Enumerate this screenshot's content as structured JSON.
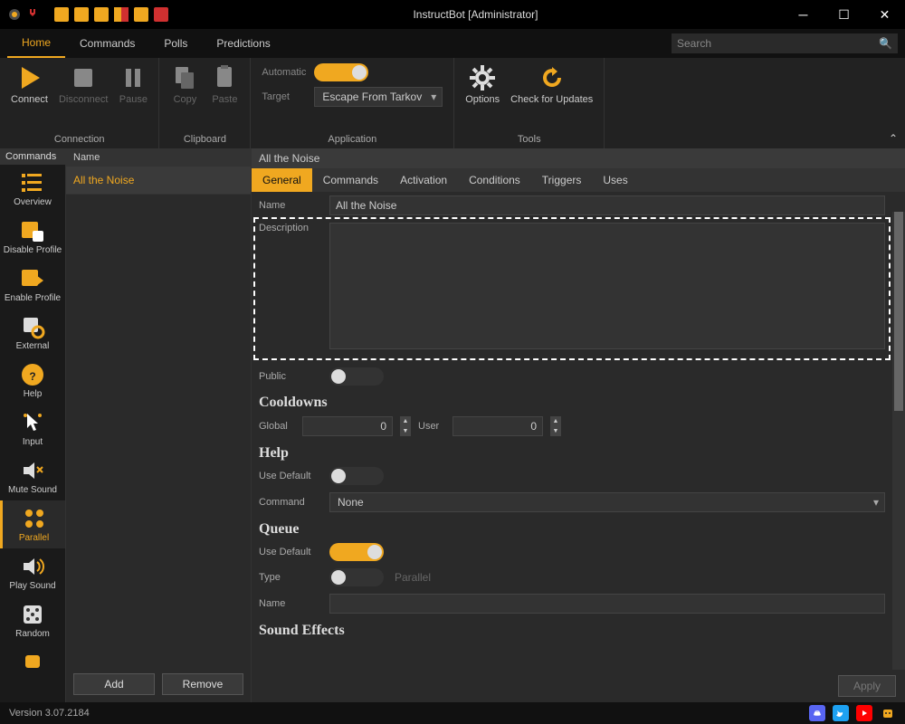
{
  "window": {
    "title": "InstructBot [Administrator]"
  },
  "tabs": {
    "home": "Home",
    "commands": "Commands",
    "polls": "Polls",
    "predictions": "Predictions",
    "search_placeholder": "Search"
  },
  "ribbon": {
    "connection": {
      "connect": "Connect",
      "disconnect": "Disconnect",
      "pause": "Pause",
      "group": "Connection"
    },
    "clipboard": {
      "copy": "Copy",
      "paste": "Paste",
      "group": "Clipboard"
    },
    "application": {
      "automatic": "Automatic",
      "target": "Target",
      "target_value": "Escape From Tarkov",
      "group": "Application"
    },
    "tools": {
      "options": "Options",
      "check_updates": "Check for Updates",
      "group": "Tools"
    }
  },
  "sidebar": {
    "title": "Commands",
    "items": [
      {
        "label": "Overview"
      },
      {
        "label": "Disable Profile"
      },
      {
        "label": "Enable Profile"
      },
      {
        "label": "External"
      },
      {
        "label": "Help"
      },
      {
        "label": "Input"
      },
      {
        "label": "Mute Sound"
      },
      {
        "label": "Parallel"
      },
      {
        "label": "Play Sound"
      },
      {
        "label": "Random"
      }
    ]
  },
  "list": {
    "header": "Name",
    "item": "All the Noise",
    "add": "Add",
    "remove": "Remove"
  },
  "detail": {
    "header": "All the Noise",
    "tabs": {
      "general": "General",
      "commands": "Commands",
      "activation": "Activation",
      "conditions": "Conditions",
      "triggers": "Triggers",
      "uses": "Uses"
    },
    "labels": {
      "name": "Name",
      "description": "Description",
      "public": "Public",
      "global": "Global",
      "user": "User",
      "use_default": "Use Default",
      "command": "Command",
      "type": "Type",
      "queue_name": "Name"
    },
    "values": {
      "name": "All the Noise",
      "global": "0",
      "user": "0",
      "command": "None",
      "type_hint": "Parallel"
    },
    "sections": {
      "cooldowns": "Cooldowns",
      "help": "Help",
      "queue": "Queue",
      "sound_effects": "Sound Effects"
    },
    "apply": "Apply"
  },
  "status": {
    "version": "Version 3.07.2184"
  },
  "colors": {
    "accent": "#f0a820"
  }
}
